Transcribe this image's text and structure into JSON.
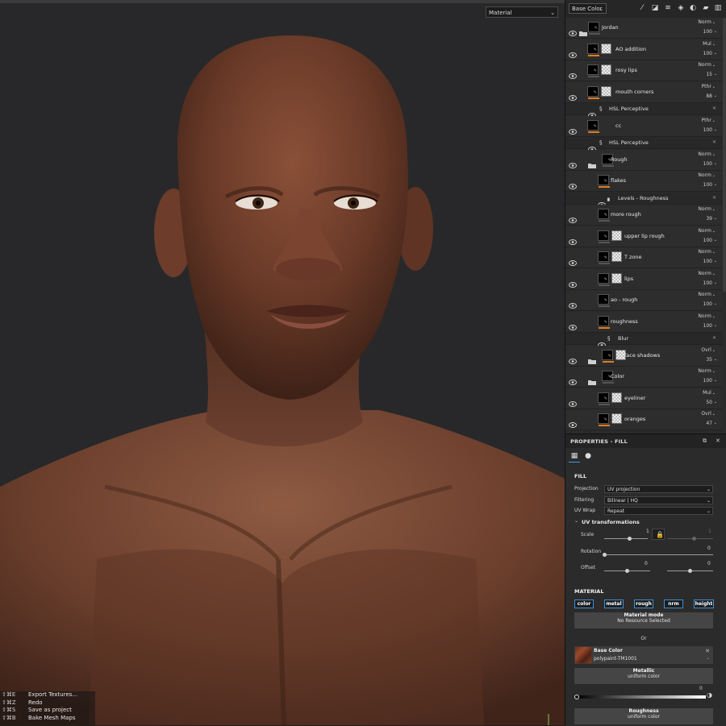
{
  "viewport": {
    "material_select": "Material",
    "shortcuts": [
      {
        "key": "⇧⌘E",
        "label": "Export Textures..."
      },
      {
        "key": "⇧⌘Z",
        "label": "Redo"
      },
      {
        "key": "⇧⌘S",
        "label": "Save as project"
      },
      {
        "key": "⇧⌘B",
        "label": "Bake Mesh Maps"
      }
    ]
  },
  "layers_panel": {
    "channel_select": "Base Color",
    "toolbar_icons": [
      "magic-wand-icon",
      "add-mask-icon",
      "add-layer-icon",
      "add-effect-icon",
      "fill-layer-icon",
      "folder-icon",
      "delete-icon"
    ],
    "layers": [
      {
        "name": "Jordan",
        "blend": "Norm",
        "opacity": "100"
      },
      {
        "name": "AO addition",
        "blend": "Mul",
        "opacity": "100"
      },
      {
        "name": "rosy lips",
        "blend": "Norm",
        "opacity": "15"
      },
      {
        "name": "mouth corners",
        "blend": "Pthr",
        "opacity": "88"
      },
      {
        "name": "HSL Perceptive"
      },
      {
        "name": "cc",
        "blend": "Pthr",
        "opacity": "100"
      },
      {
        "name": "HSL Perceptive"
      },
      {
        "name": "Rough",
        "blend": "Norm",
        "opacity": "100"
      },
      {
        "name": "flakes",
        "blend": "Norm",
        "opacity": "100"
      },
      {
        "name": "Levels - Roughness"
      },
      {
        "name": "more rough",
        "blend": "Norm",
        "opacity": "39"
      },
      {
        "name": "upper lip rough",
        "blend": "Norm",
        "opacity": "100"
      },
      {
        "name": "T zone",
        "blend": "Norm",
        "opacity": "100"
      },
      {
        "name": "lips",
        "blend": "Norm",
        "opacity": "100"
      },
      {
        "name": "ao - rough",
        "blend": "Norm",
        "opacity": "100"
      },
      {
        "name": "roughness",
        "blend": "Norm",
        "opacity": "100"
      },
      {
        "name": "Blur"
      },
      {
        "name": "face shadows",
        "blend": "Ovrl",
        "opacity": "35"
      },
      {
        "name": "Color",
        "blend": "Norm",
        "opacity": "100"
      },
      {
        "name": "eyeliner",
        "blend": "Mul",
        "opacity": "50"
      },
      {
        "name": "oranges",
        "blend": "Ovrl",
        "opacity": "47"
      }
    ]
  },
  "properties": {
    "title": "PROPERTIES - FILL",
    "fill_section": "FILL",
    "projection_label": "Projection",
    "projection_value": "UV projection",
    "filtering_label": "Filtering",
    "filtering_value": "Bilinear | HQ",
    "uvwrap_label": "UV Wrap",
    "uvwrap_value": "Repeat",
    "uv_transformations": "UV transformations",
    "scale_label": "Scale",
    "scale_value": "1",
    "scale_value2": "1",
    "rotation_label": "Rotation",
    "rotation_value": "0",
    "offset_label": "Offset",
    "offset_value_u": "0",
    "offset_value_v": "0",
    "material_section": "MATERIAL",
    "channels": [
      "color",
      "metal",
      "rough",
      "nrm",
      "height"
    ],
    "material_mode_title": "Material mode",
    "material_mode_value": "No Resource Selected",
    "or_label": "Or",
    "base_color_title": "Base Color",
    "base_color_value": "polypaint-TM1001",
    "metallic_title": "Metallic",
    "metallic_value": "uniform color",
    "metallic_number": "0",
    "roughness_title": "Roughness",
    "roughness_value": "uniform color"
  },
  "colors": {
    "accent_orange": "#e07b20",
    "accent_blue": "#3a8fd8",
    "panel_bg": "#2b2b2b",
    "viewport_bg": "#28282a"
  }
}
